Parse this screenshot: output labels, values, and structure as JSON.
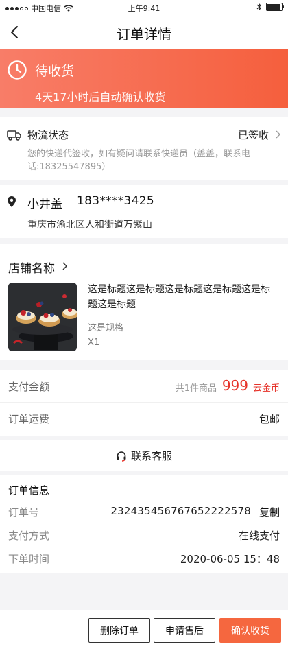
{
  "status_bar": {
    "carrier": "中国电信",
    "time": "上午9:41"
  },
  "nav": {
    "title": "订单详情"
  },
  "banner": {
    "status": "待收货",
    "subtitle": "4天17小时后自动确认收货",
    "gradient_colors": [
      "#f87d68",
      "#f55f3d"
    ]
  },
  "logistics": {
    "label": "物流状态",
    "state": "已签收",
    "description": "您的快递代签收，如有疑问请联系快递员（盖盖，联系电话:18325547895）"
  },
  "address": {
    "name": "小井盖",
    "phone": "183****3425",
    "detail": "重庆市渝北区人和街道万紫山"
  },
  "shop": {
    "name": "店铺名称",
    "product": {
      "title": "这是标题这是标题这是标题这是标题这是标题这是标题",
      "spec": "这是规格",
      "quantity": "X1"
    }
  },
  "payment": {
    "amount_label": "支付金额",
    "item_count": "共1件商品",
    "amount": "999",
    "currency": "云金币",
    "shipping_label": "订单运费",
    "shipping_value": "包邮",
    "accent_color": "#e6332a"
  },
  "service": {
    "label": "联系客服"
  },
  "order_info": {
    "title": "订单信息",
    "order_no_label": "订单号",
    "order_no": "23243545676765222257​8",
    "copy_label": "复制",
    "pay_method_label": "支付方式",
    "pay_method": "在线支付",
    "order_time_label": "下单时间",
    "order_time": "2020-06-05 15：48"
  },
  "actions": {
    "delete": "删除订单",
    "after_sale": "申请售后",
    "confirm": "确认收货",
    "primary_color": "#f5673f"
  }
}
